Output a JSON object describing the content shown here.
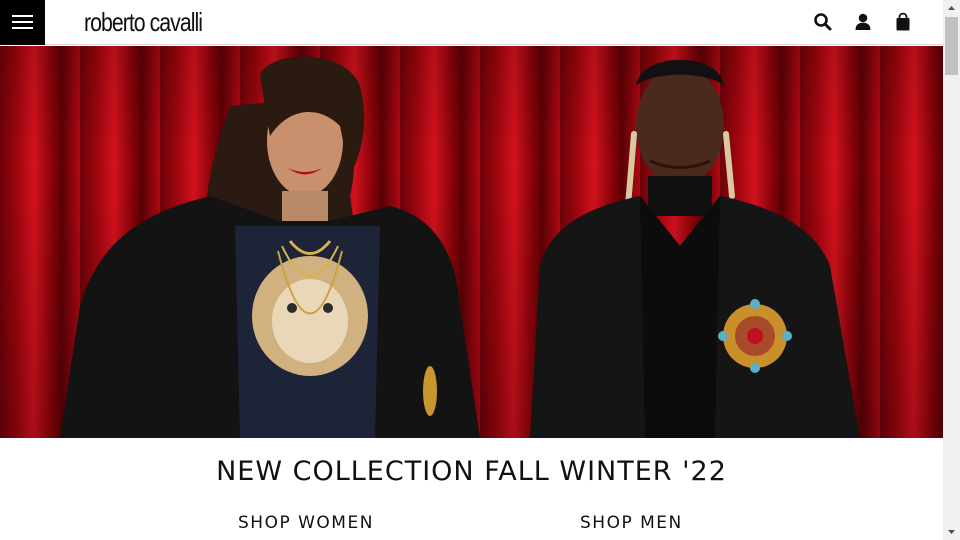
{
  "header": {
    "logo_text": "roberto cavalli",
    "icons": [
      "menu-icon",
      "search-icon",
      "user-icon",
      "bag-icon"
    ]
  },
  "hero": {
    "image": "two models in black tailored jackets with gold jewelry in front of a red velvet curtain"
  },
  "main": {
    "title": "NEW COLLECTION FALL WINTER '22",
    "links": {
      "shop_women": "SHOP WOMEN",
      "shop_men": "SHOP MEN"
    }
  },
  "colors": {
    "header_bg": "#ffffff",
    "menu_bg": "#000000",
    "curtain_red": "#b20812",
    "text": "#111111"
  }
}
